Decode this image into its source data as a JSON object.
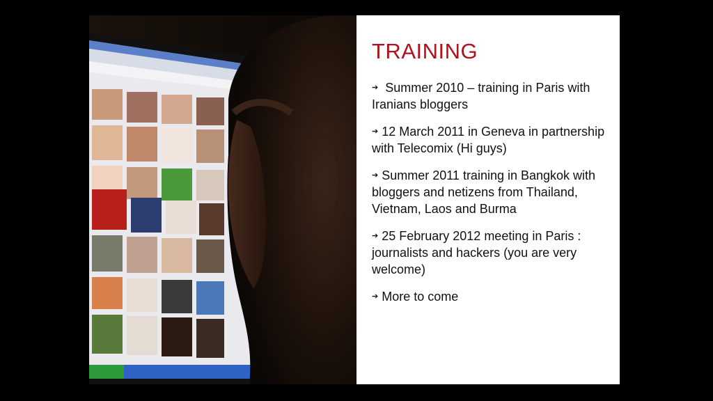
{
  "slide": {
    "title": "TRAINING",
    "bullets": [
      {
        "marker": "➔",
        "text": " Summer 2010 – training in Paris with Iranians bloggers"
      },
      {
        "marker": "➔",
        "text": "12 March 2011 in Geneva in partnership with Telecomix (Hi guys)"
      },
      {
        "marker": "➔",
        "text": "Summer 2011 training in Bangkok with bloggers and netizens from Thailand, Vietnam, Laos and Burma"
      },
      {
        "marker": "➔",
        "text": "25 February 2012 meeting in Paris : journalists and hackers (you are very welcome)"
      },
      {
        "marker": "➔",
        "text": "More to come"
      }
    ]
  },
  "colors": {
    "title": "#b0121b",
    "background": "#000000",
    "slide": "#ffffff"
  }
}
